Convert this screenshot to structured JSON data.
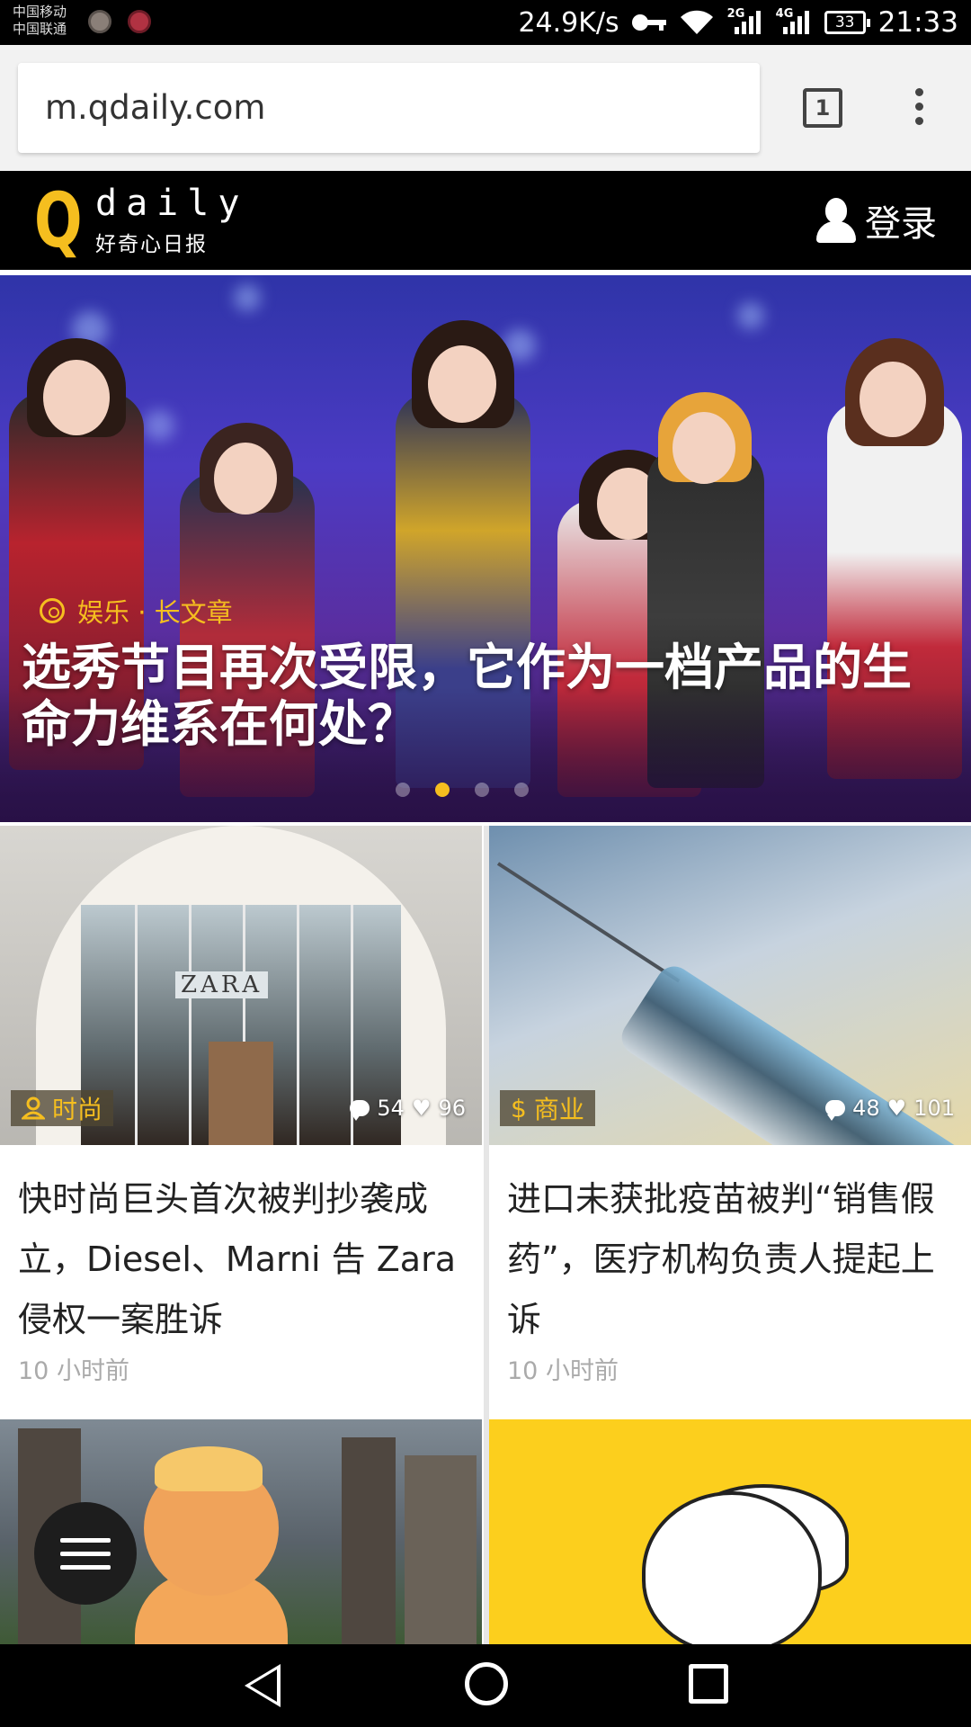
{
  "status_bar": {
    "carrier_1": "中国移动",
    "carrier_2": "中国联通",
    "net_speed": "24.9K/s",
    "signal_tag_1": "2G",
    "signal_tag_2": "4G",
    "battery": "33",
    "time": "21:33"
  },
  "browser": {
    "url": "m.qdaily.com",
    "tab_count": "1"
  },
  "site_header": {
    "logo_letter": "Q",
    "logo_word": "daily",
    "logo_sub": "好奇心日报",
    "login_label": "登录"
  },
  "hero": {
    "category": "娱乐 · 长文章",
    "title": "选秀节目再次受限，它作为一档产品的生命力维系在何处？",
    "active_slide": 2,
    "slide_count": 4
  },
  "cards": [
    {
      "tag": "时尚",
      "tag_icon": "person-icon",
      "comments": "54",
      "likes": "96",
      "title": "快时尚巨头首次被判抄袭成立，Diesel、Marni 告 Zara 侵权一案胜诉",
      "time": "10 小时前",
      "image_sign": "ZARA"
    },
    {
      "tag": "商业",
      "tag_icon": "dollar-icon",
      "comments": "48",
      "likes": "101",
      "title": "进口未获批疫苗被判“销售假药”，医疗机构负责人提起上诉",
      "time": "10 小时前"
    }
  ],
  "colors": {
    "accent": "#f5be1f",
    "header_bg": "#000000",
    "text": "#222222",
    "muted": "#aaaaaa"
  }
}
